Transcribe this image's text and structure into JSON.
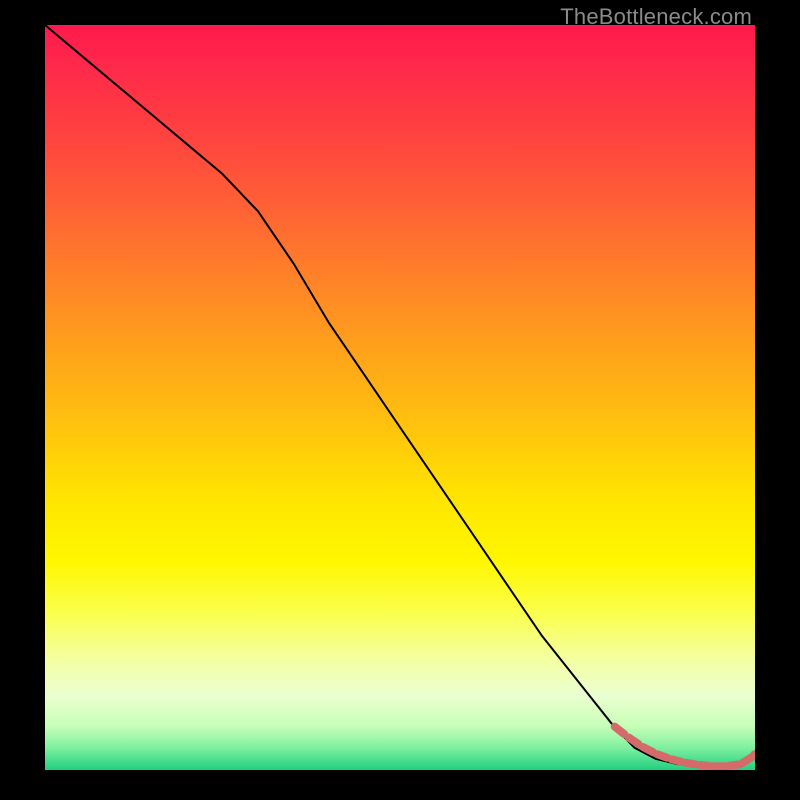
{
  "watermark": "TheBottleneck.com",
  "colors": {
    "curve": "#000000",
    "marker": "#d46a6a",
    "background_top": "#ff1a4d",
    "background_bottom": "#20d080"
  },
  "chart_data": {
    "type": "line",
    "title": "",
    "xlabel": "",
    "ylabel": "",
    "xlim": [
      0,
      100
    ],
    "ylim": [
      0,
      100
    ],
    "x": [
      0,
      5,
      10,
      15,
      20,
      25,
      30,
      35,
      40,
      45,
      50,
      55,
      60,
      65,
      70,
      75,
      80,
      83,
      86,
      89,
      92,
      95,
      98,
      100
    ],
    "values": [
      100,
      96,
      92,
      88,
      84,
      80,
      75,
      68,
      60,
      53,
      46,
      39,
      32,
      25,
      18,
      12,
      6,
      3,
      1.5,
      0.8,
      0.5,
      0.4,
      0.5,
      2
    ],
    "markers": {
      "comment": "highlighted segment near bottom-right (dashed salmon)",
      "x": [
        80,
        82,
        84,
        86,
        88,
        90,
        92,
        94,
        96,
        98,
        100
      ],
      "values": [
        6,
        4.5,
        3.2,
        2.2,
        1.5,
        1.0,
        0.7,
        0.5,
        0.5,
        0.8,
        2
      ]
    }
  }
}
